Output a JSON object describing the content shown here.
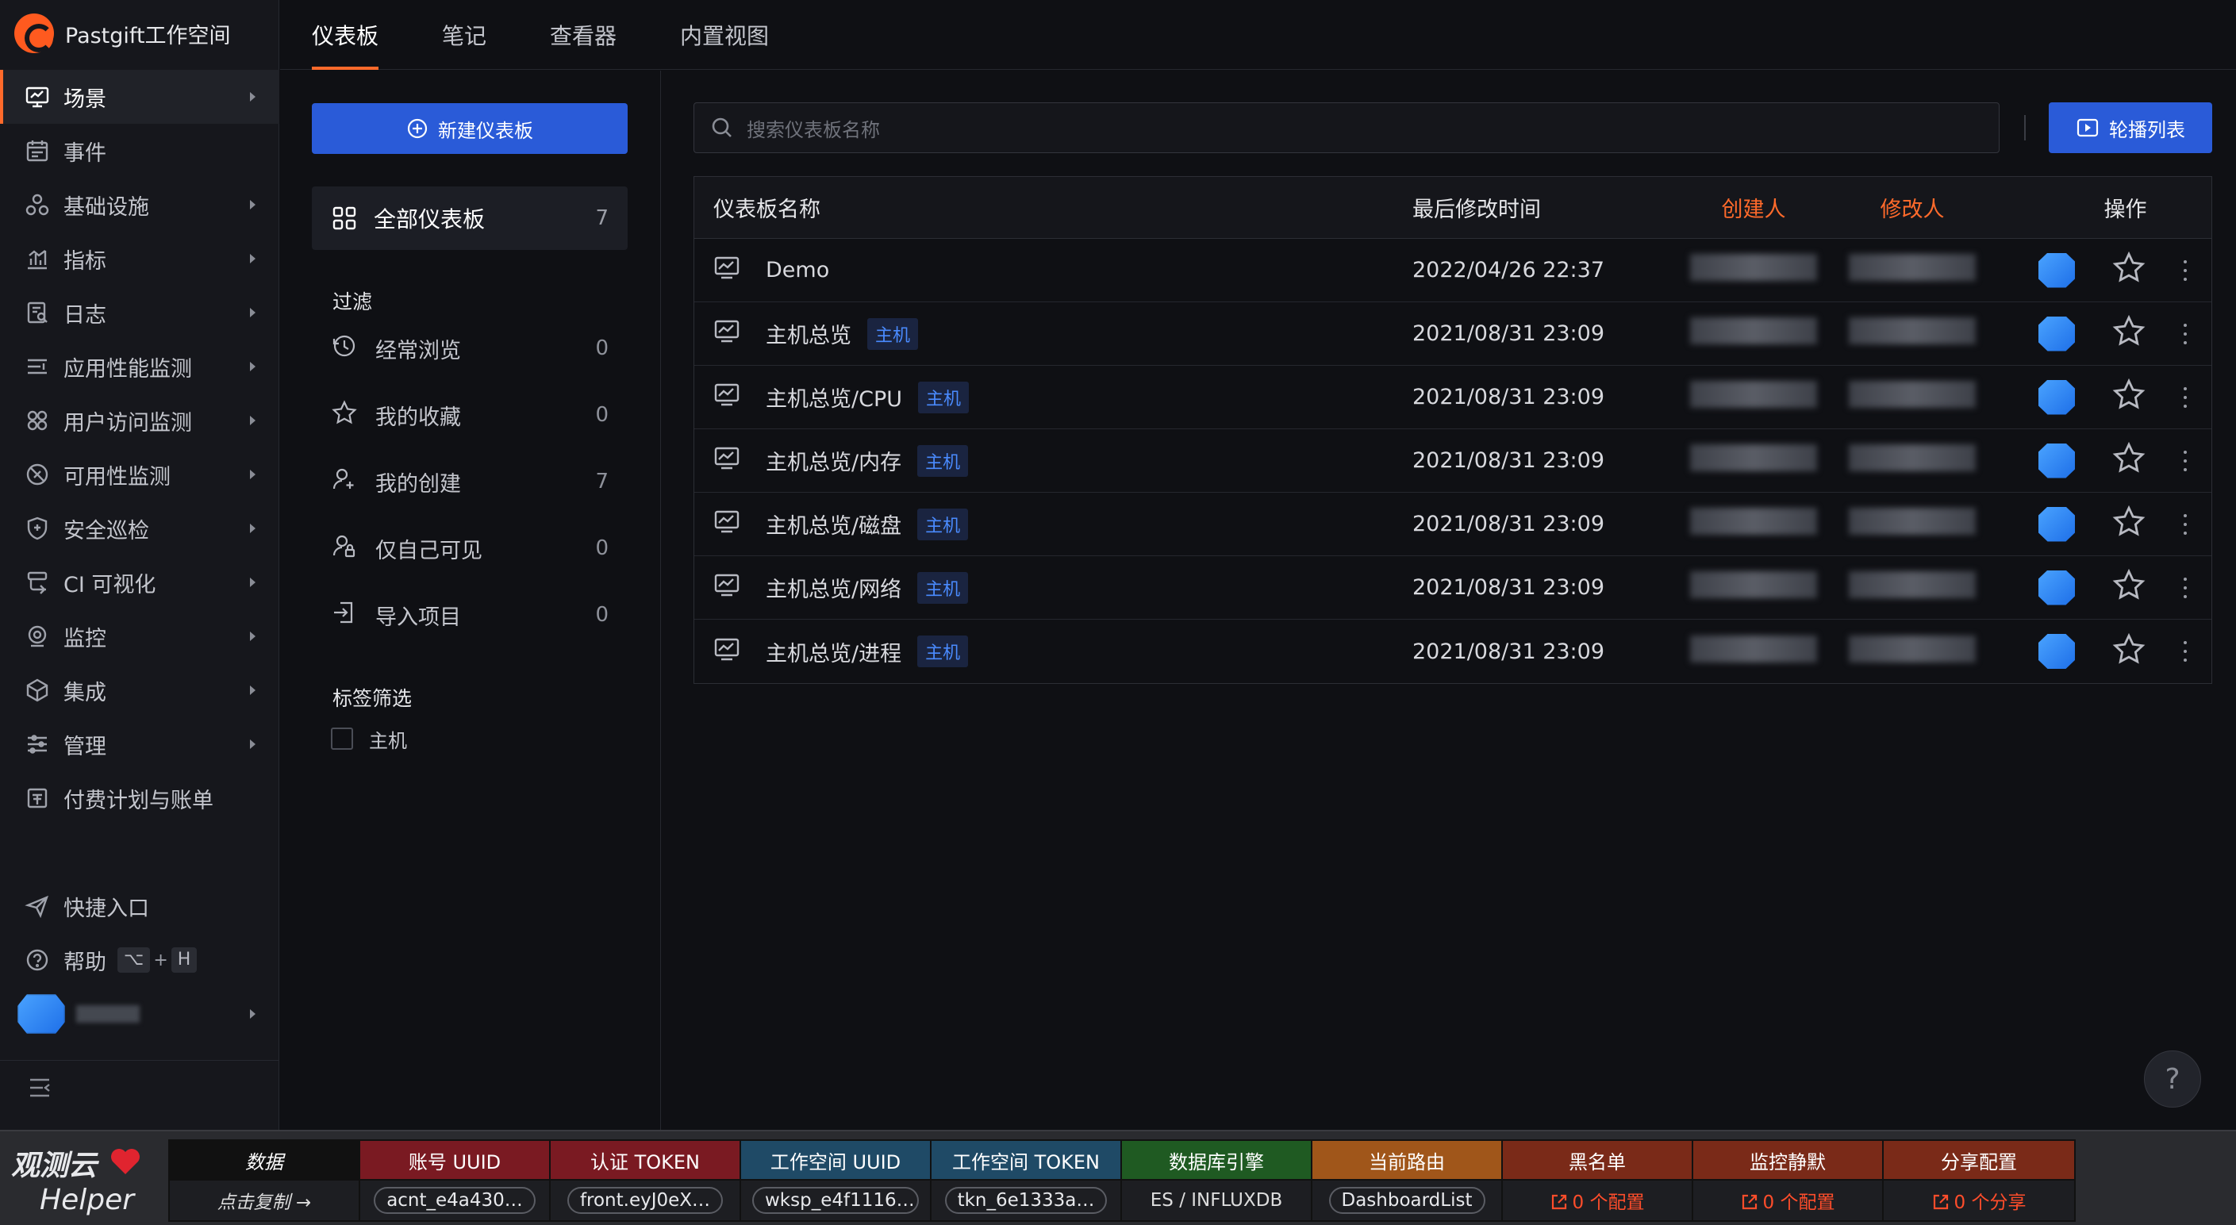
{
  "workspace": {
    "name": "Pastgift工作空间"
  },
  "sidebar": {
    "items": [
      {
        "label": "场景",
        "icon": "monitor-icon",
        "active": true,
        "chevron": true
      },
      {
        "label": "事件",
        "icon": "calendar-icon",
        "active": false,
        "chevron": false
      },
      {
        "label": "基础设施",
        "icon": "infrastructure-icon",
        "active": false,
        "chevron": true
      },
      {
        "label": "指标",
        "icon": "bar-chart-icon",
        "active": false,
        "chevron": true
      },
      {
        "label": "日志",
        "icon": "log-icon",
        "active": false,
        "chevron": true
      },
      {
        "label": "应用性能监测",
        "icon": "apm-icon",
        "active": false,
        "chevron": true
      },
      {
        "label": "用户访问监测",
        "icon": "rum-icon",
        "active": false,
        "chevron": true
      },
      {
        "label": "可用性监测",
        "icon": "availability-icon",
        "active": false,
        "chevron": true
      },
      {
        "label": "安全巡检",
        "icon": "shield-icon",
        "active": false,
        "chevron": true
      },
      {
        "label": "CI 可视化",
        "icon": "ci-icon",
        "active": false,
        "chevron": true
      },
      {
        "label": "监控",
        "icon": "camera-icon",
        "active": false,
        "chevron": true
      },
      {
        "label": "集成",
        "icon": "cube-icon",
        "active": false,
        "chevron": true
      },
      {
        "label": "管理",
        "icon": "sliders-icon",
        "active": false,
        "chevron": true
      },
      {
        "label": "付费计划与账单",
        "icon": "billing-icon",
        "active": false,
        "chevron": false
      }
    ],
    "shortcut_label": "快捷入口",
    "help_label": "帮助",
    "help_key_1": "⌥",
    "help_plus": "+",
    "help_key_2": "H"
  },
  "tabs": [
    {
      "label": "仪表板",
      "active": true
    },
    {
      "label": "笔记",
      "active": false
    },
    {
      "label": "查看器",
      "active": false
    },
    {
      "label": "内置视图",
      "active": false
    }
  ],
  "left_panel": {
    "new_button": "新建仪表板",
    "all_label": "全部仪表板",
    "all_count": "7",
    "filter_title": "过滤",
    "filters": [
      {
        "label": "经常浏览",
        "count": "0",
        "icon": "history-icon"
      },
      {
        "label": "我的收藏",
        "count": "0",
        "icon": "star-icon"
      },
      {
        "label": "我的创建",
        "count": "7",
        "icon": "user-add-icon"
      },
      {
        "label": "仅自己可见",
        "count": "0",
        "icon": "user-lock-icon"
      },
      {
        "label": "导入项目",
        "count": "0",
        "icon": "import-icon"
      }
    ],
    "tag_title": "标签筛选",
    "tags": [
      {
        "label": "主机",
        "checked": false
      }
    ]
  },
  "main": {
    "search_placeholder": "搜索仪表板名称",
    "carousel_button": "轮播列表",
    "columns": {
      "name": "仪表板名称",
      "modified": "最后修改时间",
      "creator": "创建人",
      "modifier": "修改人",
      "ops": "操作"
    },
    "rows": [
      {
        "name": "Demo",
        "tag": "",
        "time": "2022/04/26 22:37"
      },
      {
        "name": "主机总览",
        "tag": "主机",
        "time": "2021/08/31 23:09"
      },
      {
        "name": "主机总览/CPU",
        "tag": "主机",
        "time": "2021/08/31 23:09"
      },
      {
        "name": "主机总览/内存",
        "tag": "主机",
        "time": "2021/08/31 23:09"
      },
      {
        "name": "主机总览/磁盘",
        "tag": "主机",
        "time": "2021/08/31 23:09"
      },
      {
        "name": "主机总览/网络",
        "tag": "主机",
        "time": "2021/08/31 23:09"
      },
      {
        "name": "主机总览/进程",
        "tag": "主机",
        "time": "2021/08/31 23:09"
      }
    ],
    "help_fab": "?"
  },
  "helper": {
    "logo_line1": "观测云",
    "logo_line2": "Helper",
    "columns": [
      {
        "header": "数据",
        "value": "点击复制 →",
        "bg": "#111111",
        "kind": "text"
      },
      {
        "header": "账号 UUID",
        "value": "acnt_e4a430…",
        "bg": "#7a1a22",
        "kind": "pill"
      },
      {
        "header": "认证 TOKEN",
        "value": "front.eyJ0eX…",
        "bg": "#7a1a22",
        "kind": "pill"
      },
      {
        "header": "工作空间 UUID",
        "value": "wksp_e4f1116…",
        "bg": "#1f4a66",
        "kind": "pill"
      },
      {
        "header": "工作空间 TOKEN",
        "value": "tkn_6e1333a…",
        "bg": "#1f4a66",
        "kind": "pill"
      },
      {
        "header": "数据库引擎",
        "value": "ES / INFLUXDB",
        "bg": "#1f5a22",
        "kind": "text"
      },
      {
        "header": "当前路由",
        "value": "DashboardList",
        "bg": "#a0561a",
        "kind": "pill"
      },
      {
        "header": "黑名单",
        "value": "0 个配置",
        "bg": "#7a2a18",
        "kind": "link"
      },
      {
        "header": "监控静默",
        "value": "0 个配置",
        "bg": "#7a2a18",
        "kind": "link"
      },
      {
        "header": "分享配置",
        "value": "0 个分享",
        "bg": "#7a2a18",
        "kind": "link"
      }
    ]
  }
}
